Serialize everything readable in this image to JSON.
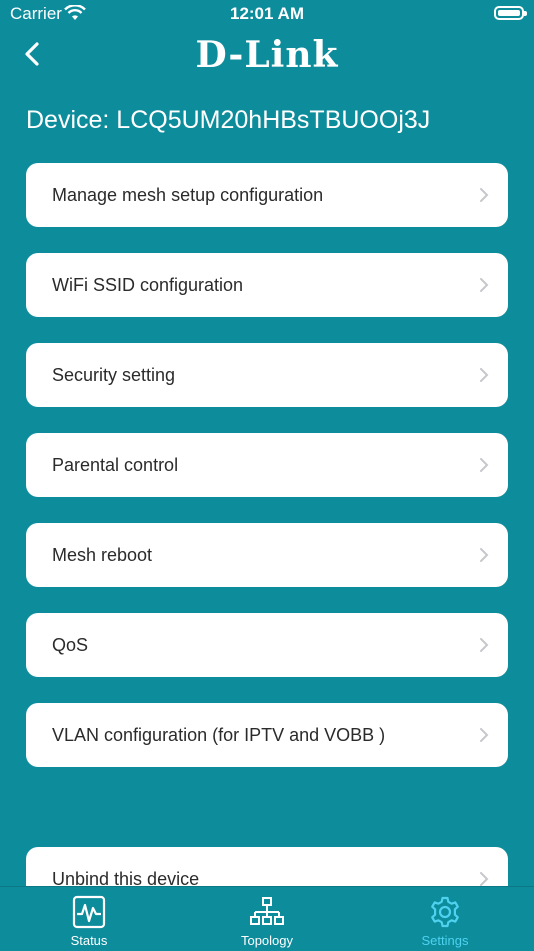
{
  "status_bar": {
    "carrier": "Carrier",
    "time": "12:01 AM"
  },
  "header": {
    "logo": "D-Link",
    "back_icon": "chevron-left-icon"
  },
  "device": {
    "title": "Device: LCQ5UM20hHBsTBUOOj3J"
  },
  "menu": {
    "items": [
      {
        "label": "Manage mesh setup configuration"
      },
      {
        "label": "WiFi SSID configuration"
      },
      {
        "label": "Security setting"
      },
      {
        "label": "Parental control"
      },
      {
        "label": "Mesh reboot"
      },
      {
        "label": "QoS"
      },
      {
        "label": "VLAN configuration (for IPTV and VOBB )"
      }
    ],
    "unbind": {
      "label": "Unbind this device"
    }
  },
  "tabs": [
    {
      "label": "Status",
      "icon": "status-chart-icon"
    },
    {
      "label": "Topology",
      "icon": "topology-icon"
    },
    {
      "label": "Settings",
      "icon": "gear-icon",
      "active": true
    }
  ],
  "colors": {
    "background": "#0D8C9C",
    "active_tab": "#4fd2f0",
    "card": "#ffffff"
  }
}
